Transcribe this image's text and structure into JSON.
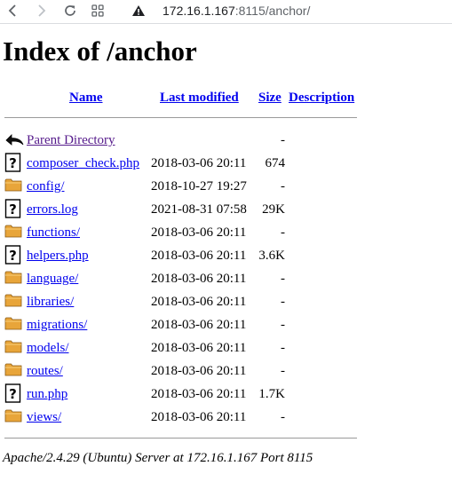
{
  "browser": {
    "url_host": "172.16.1.167",
    "url_rest": ":8115/anchor/"
  },
  "page": {
    "title": "Index of /anchor",
    "headers": {
      "name": "Name",
      "last_modified": "Last modified",
      "size": "Size",
      "description": "Description"
    },
    "entries": [
      {
        "name": "Parent Directory",
        "modified": "",
        "size": "-",
        "icon": "back-arrow-icon",
        "visited": true
      },
      {
        "name": "composer_check.php",
        "modified": "2018-03-06 20:11",
        "size": "674",
        "icon": "unknown-file-icon"
      },
      {
        "name": "config/",
        "modified": "2018-10-27 19:27",
        "size": "-",
        "icon": "folder-icon"
      },
      {
        "name": "errors.log",
        "modified": "2021-08-31 07:58",
        "size": "29K",
        "icon": "unknown-file-icon"
      },
      {
        "name": "functions/",
        "modified": "2018-03-06 20:11",
        "size": "-",
        "icon": "folder-icon"
      },
      {
        "name": "helpers.php",
        "modified": "2018-03-06 20:11",
        "size": "3.6K",
        "icon": "unknown-file-icon"
      },
      {
        "name": "language/",
        "modified": "2018-03-06 20:11",
        "size": "-",
        "icon": "folder-icon"
      },
      {
        "name": "libraries/",
        "modified": "2018-03-06 20:11",
        "size": "-",
        "icon": "folder-icon"
      },
      {
        "name": "migrations/",
        "modified": "2018-03-06 20:11",
        "size": "-",
        "icon": "folder-icon"
      },
      {
        "name": "models/",
        "modified": "2018-03-06 20:11",
        "size": "-",
        "icon": "folder-icon"
      },
      {
        "name": "routes/",
        "modified": "2018-03-06 20:11",
        "size": "-",
        "icon": "folder-icon"
      },
      {
        "name": "run.php",
        "modified": "2018-03-06 20:11",
        "size": "1.7K",
        "icon": "unknown-file-icon"
      },
      {
        "name": "views/",
        "modified": "2018-03-06 20:11",
        "size": "-",
        "icon": "folder-icon"
      }
    ],
    "footer": "Apache/2.4.29 (Ubuntu) Server at 172.16.1.167 Port 8115"
  },
  "colors": {
    "link": "#0000ee",
    "visited_link": "#551a8b",
    "folder": "#e8a53a"
  }
}
